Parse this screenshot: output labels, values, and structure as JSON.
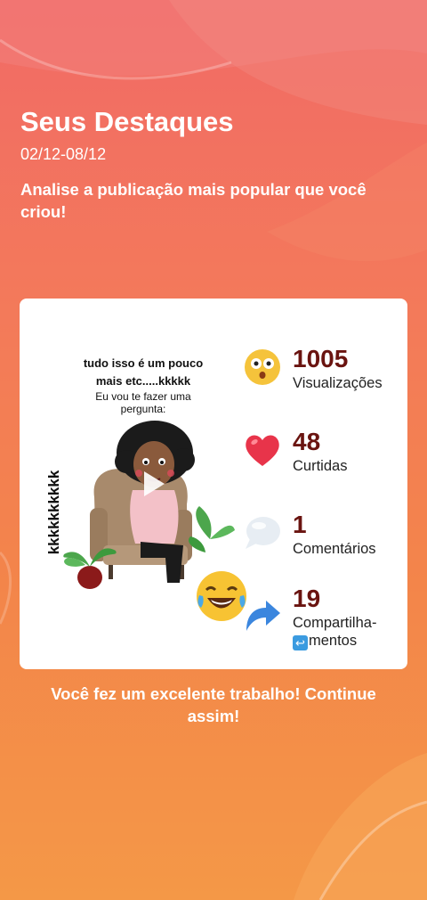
{
  "header": {
    "title": "Seus Destaques",
    "date_range": "02/12-08/12",
    "subtitle": "Analise a publicação mais popular que você criou!"
  },
  "post": {
    "caption_line1": "tudo isso é um pouco mais etc.....kkkkk",
    "caption_line2": "Eu vou te fazer uma pergunta:",
    "side_text": "kkkkkkkkkk",
    "play_icon": "play-icon",
    "emoji_icon": "laughing-tears-emoji"
  },
  "stats": [
    {
      "value": "1005",
      "label": "Visualizações",
      "icon": "shocked-face-icon",
      "color": "#f5c33b"
    },
    {
      "value": "48",
      "label": "Curtidas",
      "icon": "heart-icon",
      "color": "#e8344a"
    },
    {
      "value": "1",
      "label": "Comentários",
      "icon": "speech-bubble-icon",
      "color": "#e7edf3"
    },
    {
      "value": "19",
      "label_line1": "Compartilha-",
      "label_line2": "mentos",
      "icon": "share-arrow-icon",
      "color": "#3b86de"
    }
  ],
  "footer": {
    "message": "Você fez um excelente trabalho! Continue assim!"
  }
}
